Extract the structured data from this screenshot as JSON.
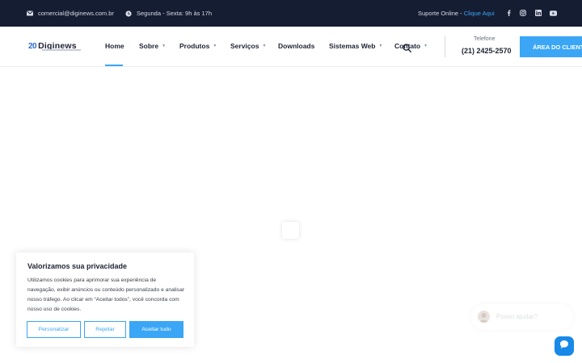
{
  "topbar": {
    "email": "comercial@diginews.com.br",
    "hours": "Segunda - Sexta: 9h às 17h",
    "support_prefix": "Suporte Online - ",
    "support_link": "Clique Aqui",
    "social": [
      "facebook-icon",
      "instagram-icon",
      "linkedin-icon",
      "youtube-icon"
    ]
  },
  "header": {
    "logo_mark": "20",
    "logo_text": "Diginews",
    "nav": [
      {
        "label": "Home",
        "active": true
      },
      {
        "label": "Sobre",
        "dropdown": true
      },
      {
        "label": "Produtos",
        "dropdown": true
      },
      {
        "label": "Serviços",
        "dropdown": true
      },
      {
        "label": "Downloads"
      },
      {
        "label": "Sistemas Web",
        "dropdown": true
      },
      {
        "label": "Contato",
        "dropdown": true
      }
    ],
    "phone_label": "Telefone",
    "phone_number": "(21) 2425-2570",
    "cta_label": "ÁREA DO CLIENTE"
  },
  "cookie": {
    "title": "Valorizamos sua privacidade",
    "text": "Utilizamos cookies para aprimorar sua experiência de navegação, exibir anúncios ou conteúdo personalizado e analisar nosso tráfego. Ao clicar em “Aceitar todos”, você concorda com nosso uso de cookies.",
    "customize_label": "Personalizar",
    "reject_label": "Rejeitar",
    "accept_label": "Aceitar tudo"
  },
  "chat": {
    "placeholder": "Posso ajudar?"
  },
  "colors": {
    "topbar_bg": "#151d33",
    "accent": "#3aa6f5",
    "chat_button": "#1789e8"
  }
}
